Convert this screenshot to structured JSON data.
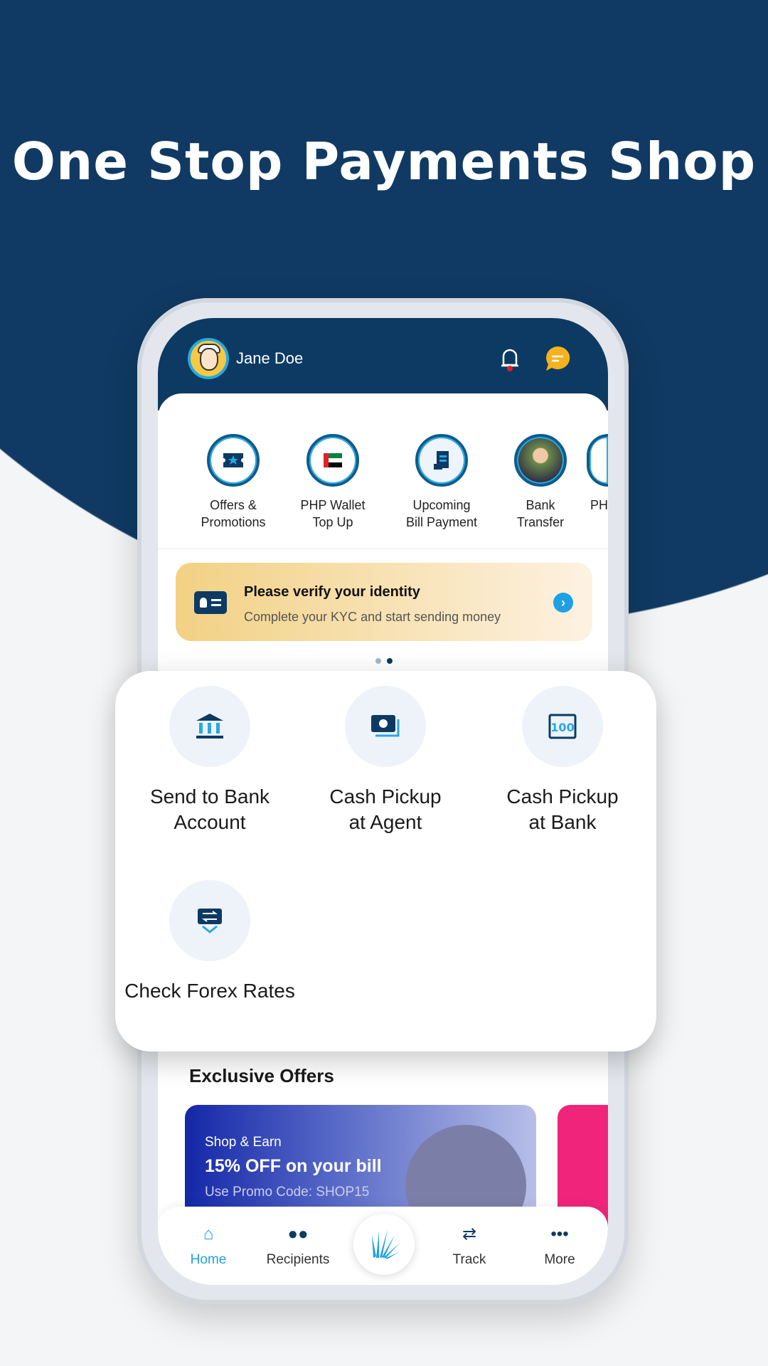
{
  "headline": "One Stop Payments Shop",
  "header": {
    "user_name": "Jane Doe"
  },
  "quick_actions": [
    {
      "line1": "Offers &",
      "line2": "Promotions",
      "icon": "ticket-star-icon"
    },
    {
      "line1": "PHP Wallet",
      "line2": "Top Up",
      "icon": "uae-flag-icon"
    },
    {
      "line1": "Upcoming",
      "line2": "Bill Payment",
      "icon": "receipt-icon"
    },
    {
      "line1": "Bank",
      "line2": "Transfer",
      "icon": "person-photo"
    },
    {
      "line1": "PH",
      "line2": "",
      "icon": "partial"
    }
  ],
  "kyc": {
    "title": "Please verify your identity",
    "subtitle": "Complete your KYC and start sending money"
  },
  "services": [
    {
      "line1": "Send to Bank",
      "line2": "Account",
      "icon": "bank-icon"
    },
    {
      "line1": "Cash Pickup",
      "line2": "at Agent",
      "icon": "cash-icon"
    },
    {
      "line1": "Cash Pickup",
      "line2": "at Bank",
      "icon": "bank-100-icon"
    },
    {
      "line1": "Check Forex Rates",
      "line2": "",
      "icon": "exchange-icon"
    }
  ],
  "offers": {
    "title": "Exclusive Offers",
    "card": {
      "tag": "Shop & Earn",
      "headline": "15% OFF on your bill",
      "promo": "Use Promo Code: SHOP15"
    }
  },
  "nav": [
    {
      "label": "Home",
      "active": true
    },
    {
      "label": "Recipients"
    },
    {
      "label": "Track"
    },
    {
      "label": "More"
    }
  ],
  "colors": {
    "navy": "#0c3a63",
    "accent": "#1fa0e4"
  }
}
